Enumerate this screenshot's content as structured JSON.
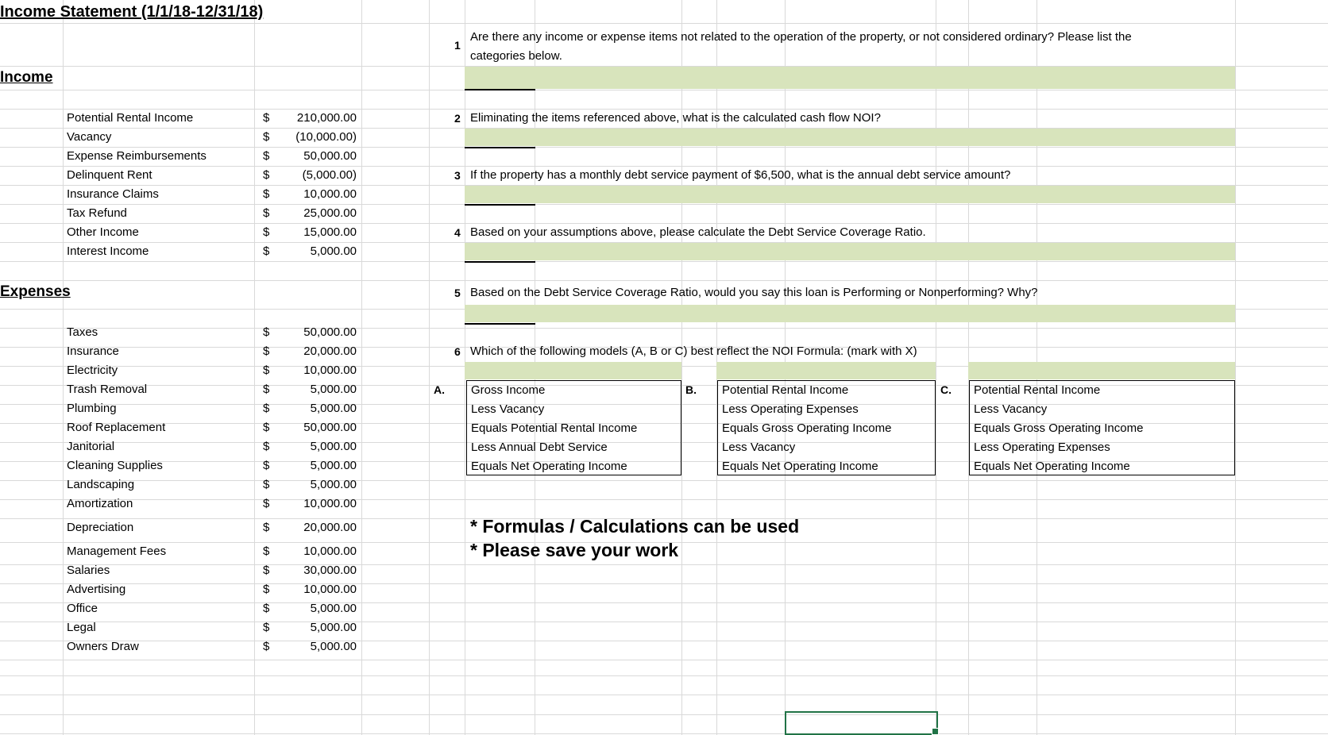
{
  "title": "Income Statement (1/1/18-12/31/18)",
  "income": {
    "header": "Income",
    "items": [
      {
        "label": "Potential Rental Income",
        "currency": "$",
        "amount": "210,000.00"
      },
      {
        "label": "Vacancy",
        "currency": "$",
        "amount": "(10,000.00)"
      },
      {
        "label": "Expense Reimbursements",
        "currency": "$",
        "amount": "50,000.00"
      },
      {
        "label": "Delinquent Rent",
        "currency": "$",
        "amount": "(5,000.00)"
      },
      {
        "label": "Insurance Claims",
        "currency": "$",
        "amount": "10,000.00"
      },
      {
        "label": "Tax Refund",
        "currency": "$",
        "amount": "25,000.00"
      },
      {
        "label": "Other Income",
        "currency": "$",
        "amount": "15,000.00"
      },
      {
        "label": "Interest Income",
        "currency": "$",
        "amount": "5,000.00"
      }
    ]
  },
  "expenses": {
    "header": "Expenses",
    "items": [
      {
        "label": "Taxes",
        "currency": "$",
        "amount": "50,000.00"
      },
      {
        "label": "Insurance",
        "currency": "$",
        "amount": "20,000.00"
      },
      {
        "label": "Electricity",
        "currency": "$",
        "amount": "10,000.00"
      },
      {
        "label": "Trash Removal",
        "currency": "$",
        "amount": "5,000.00"
      },
      {
        "label": "Plumbing",
        "currency": "$",
        "amount": "5,000.00"
      },
      {
        "label": "Roof Replacement",
        "currency": "$",
        "amount": "50,000.00"
      },
      {
        "label": "Janitorial",
        "currency": "$",
        "amount": "5,000.00"
      },
      {
        "label": "Cleaning Supplies",
        "currency": "$",
        "amount": "5,000.00"
      },
      {
        "label": "Landscaping",
        "currency": "$",
        "amount": "5,000.00"
      },
      {
        "label": "Amortization",
        "currency": "$",
        "amount": "10,000.00"
      },
      {
        "label": "Depreciation",
        "currency": "$",
        "amount": "20,000.00"
      },
      {
        "label": "Management Fees",
        "currency": "$",
        "amount": "10,000.00"
      },
      {
        "label": "Salaries",
        "currency": "$",
        "amount": "30,000.00"
      },
      {
        "label": "Advertising",
        "currency": "$",
        "amount": "10,000.00"
      },
      {
        "label": "Office",
        "currency": "$",
        "amount": "5,000.00"
      },
      {
        "label": "Legal",
        "currency": "$",
        "amount": "5,000.00"
      },
      {
        "label": "Owners Draw",
        "currency": "$",
        "amount": "5,000.00"
      }
    ]
  },
  "questions": [
    {
      "num": "1",
      "line1": "Are there any income or expense items not related to the operation of the property, or not considered ordinary?  Please list the",
      "line2": "categories below."
    },
    {
      "num": "2",
      "line1": "Eliminating the items referenced above, what is the calculated cash flow NOI?"
    },
    {
      "num": "3",
      "line1": "If the property has a monthly debt service payment of $6,500, what is the annual debt service amount?"
    },
    {
      "num": "4",
      "line1": "Based on your assumptions above, please calculate the Debt Service Coverage Ratio."
    },
    {
      "num": "5",
      "line1": "Based on the Debt Service Coverage Ratio, would you say this loan is Performing or Nonperforming?  Why?"
    },
    {
      "num": "6",
      "line1": "Which of the following models (A, B or C) best reflect the NOI Formula:  (mark with X)"
    }
  ],
  "options": [
    {
      "letter": "A.",
      "lines": [
        "Gross Income",
        "Less Vacancy",
        "Equals Potential Rental Income",
        "Less Annual Debt Service",
        "Equals Net Operating Income"
      ]
    },
    {
      "letter": "B.",
      "lines": [
        "Potential Rental Income",
        "Less Operating Expenses",
        "Equals Gross Operating Income",
        "Less Vacancy",
        "Equals Net Operating Income"
      ]
    },
    {
      "letter": "C.",
      "lines": [
        "Potential Rental Income",
        "Less Vacancy",
        "Equals Gross Operating Income",
        "Less Operating Expenses",
        "Equals Net Operating Income"
      ]
    }
  ],
  "notes": [
    "* Formulas / Calculations can be used",
    "* Please save your work"
  ],
  "colors": {
    "answer_fill": "#d8e4bc",
    "gridline": "#d9d9d9",
    "selection": "#217346"
  }
}
